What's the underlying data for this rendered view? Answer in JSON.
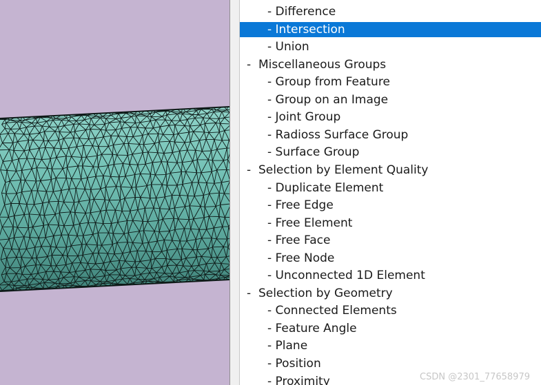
{
  "tree": {
    "items": [
      {
        "label": "- Difference",
        "level": 1,
        "selected": false
      },
      {
        "label": "- Intersection",
        "level": 1,
        "selected": true
      },
      {
        "label": "- Union",
        "level": 1,
        "selected": false
      },
      {
        "label": "-  Miscellaneous Groups",
        "level": 0,
        "selected": false
      },
      {
        "label": "- Group from Feature",
        "level": 1,
        "selected": false
      },
      {
        "label": "- Group on an Image",
        "level": 1,
        "selected": false
      },
      {
        "label": "- Joint Group",
        "level": 1,
        "selected": false
      },
      {
        "label": "- Radioss Surface Group",
        "level": 1,
        "selected": false
      },
      {
        "label": "- Surface Group",
        "level": 1,
        "selected": false
      },
      {
        "label": "-  Selection by Element Quality",
        "level": 0,
        "selected": false
      },
      {
        "label": "- Duplicate Element",
        "level": 1,
        "selected": false
      },
      {
        "label": "- Free Edge",
        "level": 1,
        "selected": false
      },
      {
        "label": "- Free Element",
        "level": 1,
        "selected": false
      },
      {
        "label": "- Free Face",
        "level": 1,
        "selected": false
      },
      {
        "label": "- Free Node",
        "level": 1,
        "selected": false
      },
      {
        "label": "- Unconnected 1D Element",
        "level": 1,
        "selected": false
      },
      {
        "label": "-  Selection by Geometry",
        "level": 0,
        "selected": false
      },
      {
        "label": "- Connected Elements",
        "level": 1,
        "selected": false
      },
      {
        "label": "- Feature Angle",
        "level": 1,
        "selected": false
      },
      {
        "label": "- Plane",
        "level": 1,
        "selected": false
      },
      {
        "label": "- Position",
        "level": 1,
        "selected": false
      },
      {
        "label": "- Proximity",
        "level": 1,
        "selected": false
      }
    ]
  },
  "watermark": "CSDN @2301_77658979",
  "colors": {
    "viewport_bg": "#c5b4d1",
    "mesh_fill": "#6fbdb1",
    "mesh_line": "#0e1a18",
    "selection": "#0a78d7"
  }
}
